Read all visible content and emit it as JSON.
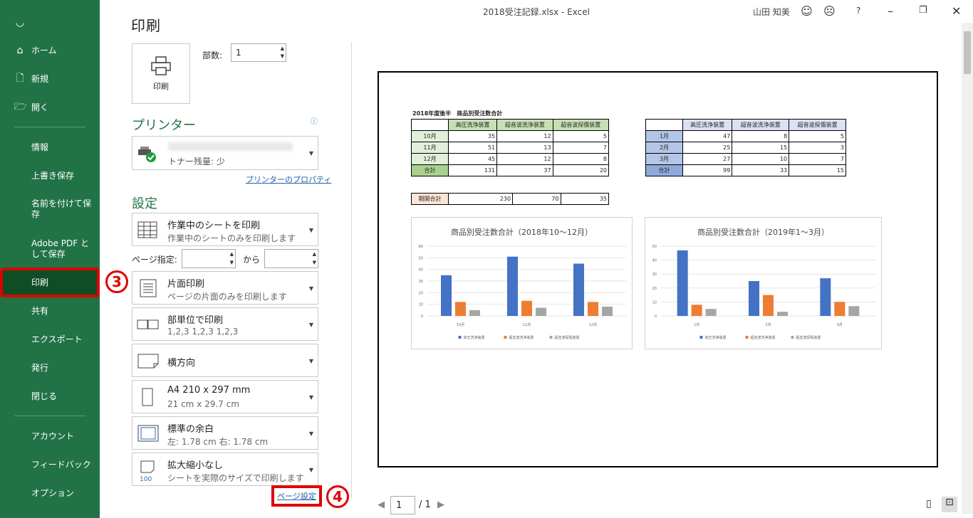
{
  "window": {
    "title": "2018受注記録.xlsx  -  Excel",
    "user": "山田 知美",
    "help": "?"
  },
  "sidebar": {
    "items": [
      {
        "label": "ホーム"
      },
      {
        "label": "新規"
      },
      {
        "label": "開く"
      },
      {
        "label": "情報"
      },
      {
        "label": "上書き保存"
      },
      {
        "label": "名前を付けて保存"
      },
      {
        "label": "Adobe PDF として保存"
      },
      {
        "label": "印刷"
      },
      {
        "label": "共有"
      },
      {
        "label": "エクスポート"
      },
      {
        "label": "発行"
      },
      {
        "label": "閉じる"
      },
      {
        "label": "アカウント"
      },
      {
        "label": "フィードバック"
      },
      {
        "label": "オプション"
      }
    ]
  },
  "print": {
    "heading": "印刷",
    "button_label": "印刷",
    "copies_label": "部数:",
    "copies_value": "1",
    "printer_heading": "プリンター",
    "printer_status": "トナー残量: 少",
    "printer_props": "プリンターのプロパティ",
    "settings_heading": "設定",
    "pages_label": "ページ指定:",
    "pages_to": "から",
    "page_setup": "ページ設定",
    "options": [
      {
        "main": "作業中のシートを印刷",
        "sub": "作業中のシートのみを印刷します"
      },
      {
        "main": "片面印刷",
        "sub": "ページの片面のみを印刷します"
      },
      {
        "main": "部単位で印刷",
        "sub": "1,2,3    1,2,3    1,2,3"
      },
      {
        "main": "横方向",
        "sub": ""
      },
      {
        "main": "A4 210 x 297 mm",
        "sub": "21 cm x 29.7 cm"
      },
      {
        "main": "標準の余白",
        "sub": "左:  1.78 cm    右:  1.78 cm"
      },
      {
        "main": "拡大縮小なし",
        "sub": "シートを実際のサイズで印刷します"
      }
    ],
    "badge3": "3",
    "badge4": "4"
  },
  "preview": {
    "sheet_title": "2018年度後半　商品別受注数合計",
    "headers": [
      "高圧洗浄装置",
      "超音波洗浄装置",
      "超音波探傷装置"
    ],
    "table1": [
      [
        "10月",
        "35",
        "12",
        "5"
      ],
      [
        "11月",
        "51",
        "13",
        "7"
      ],
      [
        "12月",
        "45",
        "12",
        "8"
      ],
      [
        "合計",
        "131",
        "37",
        "20"
      ]
    ],
    "table2": [
      [
        "1月",
        "47",
        "8",
        "5"
      ],
      [
        "2月",
        "25",
        "15",
        "3"
      ],
      [
        "3月",
        "27",
        "10",
        "7"
      ],
      [
        "合計",
        "99",
        "33",
        "15"
      ]
    ],
    "period": [
      "期間合計",
      "230",
      "70",
      "35"
    ],
    "page_current": "1",
    "page_total": "/ 1"
  },
  "chart_data": [
    {
      "type": "bar",
      "title": "商品別受注数合計（2018年10～12月）",
      "categories": [
        "10月",
        "11月",
        "12月"
      ],
      "series": [
        {
          "name": "高圧洗浄装置",
          "values": [
            35,
            51,
            45
          ],
          "color": "#4472C4"
        },
        {
          "name": "超音波洗浄装置",
          "values": [
            12,
            13,
            12
          ],
          "color": "#ED7D31"
        },
        {
          "name": "超音波探傷装置",
          "values": [
            5,
            7,
            8
          ],
          "color": "#A5A5A5"
        }
      ],
      "ylim": [
        0,
        60
      ],
      "yticks": [
        "0",
        "10",
        "20",
        "30",
        "40",
        "50",
        "60"
      ]
    },
    {
      "type": "bar",
      "title": "商品別受注数合計（2019年1～3月）",
      "categories": [
        "1月",
        "2月",
        "3月"
      ],
      "series": [
        {
          "name": "高圧洗浄装置",
          "values": [
            47,
            25,
            27
          ],
          "color": "#4472C4"
        },
        {
          "name": "超音波洗浄装置",
          "values": [
            8,
            15,
            10
          ],
          "color": "#ED7D31"
        },
        {
          "name": "超音波探傷装置",
          "values": [
            5,
            3,
            7
          ],
          "color": "#A5A5A5"
        }
      ],
      "ylim": [
        0,
        50
      ],
      "yticks": [
        "0",
        "10",
        "20",
        "30",
        "40",
        "50"
      ]
    }
  ]
}
